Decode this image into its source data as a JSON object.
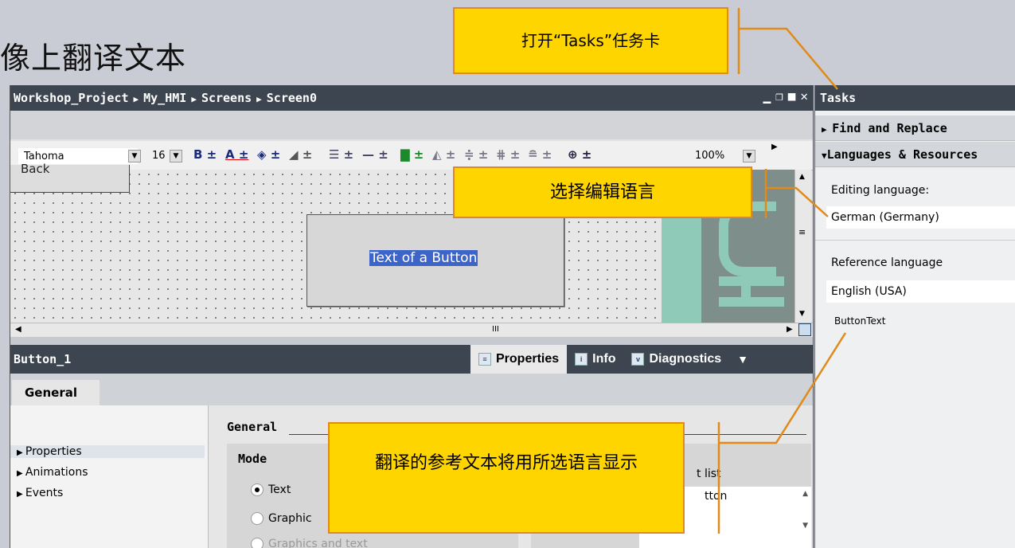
{
  "slide_title": "像上翻译文本",
  "editor": {
    "breadcrumb": [
      "Workshop_Project",
      "My_HMI",
      "Screens",
      "Screen0"
    ],
    "window_controls": [
      "▁",
      "❐",
      "■",
      "✕"
    ]
  },
  "toolbar": {
    "font_name": "Tahoma",
    "font_size": "16",
    "zoom": "100%"
  },
  "canvas": {
    "back_button_text": "Back",
    "button_text": "Text of a Button",
    "scroll_mid": "III"
  },
  "inspector": {
    "object_name": "Button_1",
    "tabs": [
      {
        "label": "Properties",
        "icon": "properties-icon"
      },
      {
        "label": "Info",
        "icon": "info-icon"
      },
      {
        "label": "Diagnostics",
        "icon": "diagnostics-icon"
      }
    ],
    "general_tab": "General",
    "nav": [
      "Properties",
      "Animations",
      "Events"
    ],
    "section_title": "General",
    "mode": {
      "title": "Mode",
      "options": [
        "Text",
        "Graphic",
        "Graphics and text"
      ]
    },
    "text_list_label": "t list",
    "list_value": "tton"
  },
  "tasks": {
    "title": "Tasks",
    "sections": [
      "Find and Replace",
      "Languages & Resources"
    ],
    "editing_language_label": "Editing language:",
    "editing_language": "German (Germany)",
    "reference_language_label": "Reference language",
    "reference_language": "English (USA)",
    "reference_text": "ButtonText"
  },
  "callouts": {
    "open_tasks": "打开“Tasks”任务卡",
    "select_language": "选择编辑语言",
    "reference_text": "翻译的参考文本将用所选语言显示"
  },
  "colors": {
    "title_bar": "#3c4550",
    "callout_fill": "#ffd500",
    "callout_border": "#e08a1a",
    "selection": "#3d64c8"
  }
}
